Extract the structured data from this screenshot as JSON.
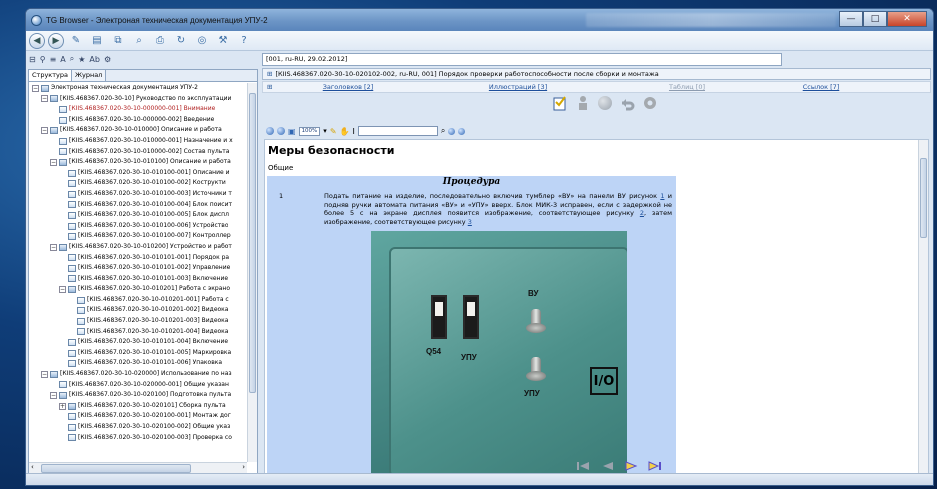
{
  "window": {
    "title": "TG Browser - Электроная техническая документация УПУ-2",
    "controls": {
      "minimize": "—",
      "maximize": "□",
      "close": "✕"
    }
  },
  "address": {
    "value": "[001, ru-RU, 29.02.2012]"
  },
  "left": {
    "tabs": [
      {
        "label": "Структура",
        "active": true
      },
      {
        "label": "Журнал",
        "active": false
      }
    ],
    "tree": [
      {
        "label": "Электроная техническая документация УПУ-2",
        "level": 0,
        "expander": "−",
        "icon": "book"
      },
      {
        "label": "[КIIS.468367.020-30-10] Руководство по эксплуатации",
        "level": 1,
        "expander": "−",
        "icon": "book"
      },
      {
        "label": "[КIIS.468367.020-30-10-000000-001] Внимание",
        "level": 2,
        "expander": "",
        "icon": "page",
        "red": true
      },
      {
        "label": "[КIIS.468367.020-30-10-000000-002] Введение",
        "level": 2,
        "expander": "",
        "icon": "page"
      },
      {
        "label": "[КIIS.468367.020-30-10-010000] Описание и работа",
        "level": 1,
        "expander": "−",
        "icon": "book"
      },
      {
        "label": "[КIIS.468367.020-30-10-010000-001] Назначение и х",
        "level": 2,
        "expander": "",
        "icon": "page"
      },
      {
        "label": "[КIIS.468367.020-30-10-010000-002] Состав пульта",
        "level": 2,
        "expander": "",
        "icon": "page"
      },
      {
        "label": "[КIIS.468367.020-30-10-010100] Описание и работа",
        "level": 2,
        "expander": "−",
        "icon": "book"
      },
      {
        "label": "[КIIS.468367.020-30-10-010100-001] Описание и",
        "level": 3,
        "expander": "",
        "icon": "page"
      },
      {
        "label": "[КIIS.468367.020-30-10-010100-002] Кострукти",
        "level": 3,
        "expander": "",
        "icon": "page"
      },
      {
        "label": "[КIIS.468367.020-30-10-010100-003] Источники т",
        "level": 3,
        "expander": "",
        "icon": "page"
      },
      {
        "label": "[КIIS.468367.020-30-10-010100-004] Блок поисит",
        "level": 3,
        "expander": "",
        "icon": "page"
      },
      {
        "label": "[КIIS.468367.020-30-10-010100-005] Блок диспл",
        "level": 3,
        "expander": "",
        "icon": "page"
      },
      {
        "label": "[КIIS.468367.020-30-10-010100-006] Устройство",
        "level": 3,
        "expander": "",
        "icon": "page"
      },
      {
        "label": "[КIIS.468367.020-30-10-010100-007] Контроллер",
        "level": 3,
        "expander": "",
        "icon": "page"
      },
      {
        "label": "[КIIS.468367.020-30-10-010200] Устройство и работ",
        "level": 2,
        "expander": "−",
        "icon": "book"
      },
      {
        "label": "[КIIS.468367.020-30-10-010101-001] Порядок ра",
        "level": 3,
        "expander": "",
        "icon": "page"
      },
      {
        "label": "[КIIS.468367.020-30-10-010101-002] Управление",
        "level": 3,
        "expander": "",
        "icon": "page"
      },
      {
        "label": "[КIIS.468367.020-30-10-010101-003] Включение",
        "level": 3,
        "expander": "",
        "icon": "page"
      },
      {
        "label": "[КIIS.468367.020-30-10-010201] Работа с экрано",
        "level": 3,
        "expander": "−",
        "icon": "book"
      },
      {
        "label": "[КIIS.468367.020-30-10-010201-001] Работа с",
        "level": 4,
        "expander": "",
        "icon": "page"
      },
      {
        "label": "[КIIS.468367.020-30-10-010201-002] Видеока",
        "level": 4,
        "expander": "",
        "icon": "page"
      },
      {
        "label": "[КIIS.468367.020-30-10-010201-003] Видеока",
        "level": 4,
        "expander": "",
        "icon": "page"
      },
      {
        "label": "[КIIS.468367.020-30-10-010201-004] Видеока",
        "level": 4,
        "expander": "",
        "icon": "page"
      },
      {
        "label": "[КIIS.468367.020-30-10-010101-004] Включение",
        "level": 3,
        "expander": "",
        "icon": "page"
      },
      {
        "label": "[КIIS.468367.020-30-10-010101-005] Маркировка",
        "level": 3,
        "expander": "",
        "icon": "page"
      },
      {
        "label": "[КIIS.468367.020-30-10-010101-006] Упаковка",
        "level": 3,
        "expander": "",
        "icon": "page"
      },
      {
        "label": "[КIIS.468367.020-30-10-020000] Использование по наз",
        "level": 1,
        "expander": "−",
        "icon": "book"
      },
      {
        "label": "[КIIS.468367.020-30-10-020000-001] Общие указан",
        "level": 2,
        "expander": "",
        "icon": "page"
      },
      {
        "label": "[КIIS.468367.020-30-10-020100] Подготовка пульта",
        "level": 2,
        "expander": "−",
        "icon": "book"
      },
      {
        "label": "[КIIS.468367.020-30-10-020101] Сборка пульта",
        "level": 3,
        "expander": "+",
        "icon": "book"
      },
      {
        "label": "[КIIS.468367.020-30-10-020100-001] Монтаж дог",
        "level": 3,
        "expander": "",
        "icon": "page"
      },
      {
        "label": "[КIIS.468367.020-30-10-020100-002] Общие указ",
        "level": 3,
        "expander": "",
        "icon": "page"
      },
      {
        "label": "[КIIS.468367.020-30-10-020100-003] Проверка со",
        "level": 3,
        "expander": "",
        "icon": "page"
      }
    ],
    "hscroll_arrows": {
      "left": "‹",
      "right": "›"
    }
  },
  "doc_header": {
    "breadcrumb_toggle": "⊞",
    "breadcrumb": "[КIIS.468367.020-30-10-020102-002, ru-RU, 001] Порядок проверки работоспособности после сборки и монтажа",
    "links_toggle": "⊞",
    "links": [
      {
        "label": "Заголовков [2]",
        "enabled": true
      },
      {
        "label": "Иллюстраций [3]",
        "enabled": true
      },
      {
        "label": "Таблиц [0]",
        "enabled": false
      },
      {
        "label": "Ссылок [7]",
        "enabled": true
      }
    ]
  },
  "viewer": {
    "zoom": "100%"
  },
  "doc": {
    "title": "Меры безопасности",
    "subtitle": "Общие",
    "procedure": {
      "heading": "Процедура",
      "step_number": "1",
      "step_text_1": "Подать питание на изделие, последовательно включив тумблер «ВУ» на панели ВУ рисунок ",
      "ref_1": "1",
      "step_text_2": " и подняв ручки автомата питания «ВУ» и «УПУ» вверх. Блок МИК-3 исправен, если с задержкой не более 5 с на экране дисплея появится изображение, соответствующее рисунку ",
      "ref_2": "2",
      "step_text_3": ", затем изображение, соответствующее рисунку ",
      "ref_3": "3"
    },
    "photo_labels": {
      "vu": "ВУ",
      "q54": "Q54",
      "upu1": "УПУ",
      "upu2": "УПУ",
      "io": "I/O"
    }
  },
  "icons": {
    "accent": "#3b6ea5",
    "link": "#1d4f9b"
  }
}
